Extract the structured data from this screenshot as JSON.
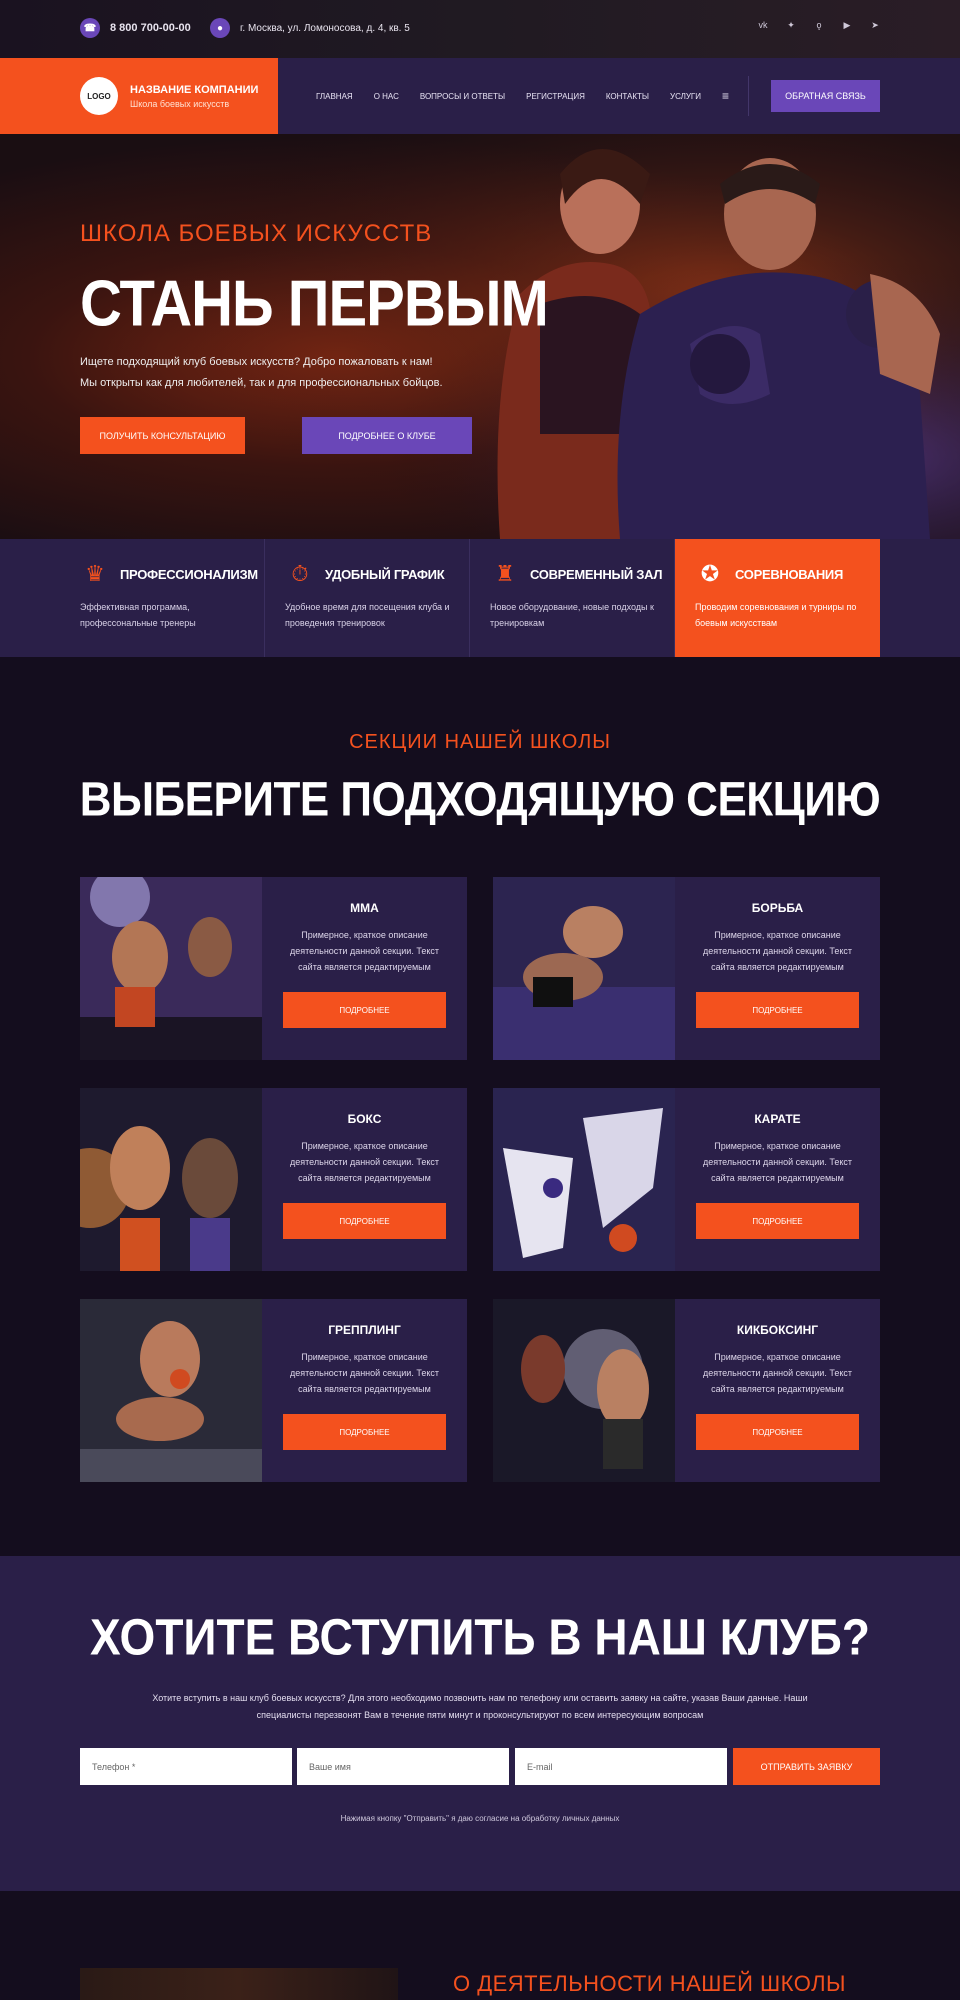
{
  "topbar": {
    "phone": "8 800 700-00-00",
    "address": "г. Москва, ул. Ломоносова, д. 4, кв. 5",
    "socials": [
      "vk",
      "twitter",
      "odnoklassniki",
      "youtube",
      "telegram"
    ]
  },
  "header": {
    "logo": "LOGO",
    "company_name": "НАЗВАНИЕ КОМПАНИИ",
    "company_sub": "Школа боевых искусств",
    "nav": [
      "ГЛАВНАЯ",
      "О НАС",
      "ВОПРОСЫ И ОТВЕТЫ",
      "РЕГИСТРАЦИЯ",
      "КОНТАКТЫ",
      "УСЛУГИ"
    ],
    "feedback": "ОБРАТНАЯ СВЯЗЬ"
  },
  "hero": {
    "subtitle": "ШКОЛА БОЕВЫХ ИСКУССТВ",
    "title": "СТАНЬ ПЕРВЫМ",
    "text_line1": "Ищете подходящий клуб боевых искусств? Добро пожаловать к нам!",
    "text_line2": "Мы открыты как для любителей, так и для профессиональных бойцов.",
    "btn_consult": "ПОЛУЧИТЬ КОНСУЛЬТАЦИЮ",
    "btn_more": "ПОДРОБНЕЕ О КЛУБЕ"
  },
  "features": [
    {
      "title": "ПРОФЕССИОНАЛИЗМ",
      "text": "Эффективная программа, професcональные тренеры",
      "icon": "award-icon"
    },
    {
      "title": "УДОБНЫЙ ГРАФИК",
      "text": "Удобное время для посещения клуба и проведения тренировок",
      "icon": "stopwatch-icon"
    },
    {
      "title": "СОВРЕМЕННЫЙ ЗАЛ",
      "text": "Новое оборудование, новые подходы к тренировкам",
      "icon": "gym-icon"
    },
    {
      "title": "СОРЕВНОВАНИЯ",
      "text": "Проводим соревнования и турниры по боевым искусствам",
      "icon": "medal-icon"
    }
  ],
  "sections": {
    "subtitle": "СЕКЦИИ НАШЕЙ ШКОЛЫ",
    "title": "ВЫБЕРИТЕ ПОДХОДЯЩУЮ СЕКЦИЮ",
    "cards": [
      {
        "title": "ММА",
        "text": "Примерное, краткое описание деятельности данной секции. Текст сайта является редактируемым",
        "button": "ПОДРОБНЕЕ"
      },
      {
        "title": "БОРЬБА",
        "text": "Примерное, краткое описание деятельности данной секции. Текст сайта является редактируемым",
        "button": "ПОДРОБНЕЕ"
      },
      {
        "title": "БОКС",
        "text": "Примерное, краткое описание деятельности данной секции. Текст сайта является редактируемым",
        "button": "ПОДРОБНЕЕ"
      },
      {
        "title": "КАРАТЕ",
        "text": "Примерное, краткое описание деятельности данной секции. Текст сайта является редактируемым",
        "button": "ПОДРОБНЕЕ"
      },
      {
        "title": "ГРЕППЛИНГ",
        "text": "Примерное, краткое описание деятельности данной секции. Текст сайта является редактируемым",
        "button": "ПОДРОБНЕЕ"
      },
      {
        "title": "КИКБОКСИНГ",
        "text": "Примерное, краткое описание деятельности данной секции. Текст сайта является редактируемым",
        "button": "ПОДРОБНЕЕ"
      }
    ]
  },
  "join": {
    "title": "ХОТИТЕ ВСТУПИТЬ В НАШ КЛУБ?",
    "text": "Хотите вступить в наш клуб боевых искусств? Для этого необходимо позвонить нам по телефону или оставить заявку на сайте, указав Ваши данные. Наши специалисты перезвонят Вам в течение пяти минут и проконсультируют по всем интересующим вопросам",
    "phone_placeholder": "Телефон *",
    "name_placeholder": "Ваше имя",
    "email_placeholder": "E-mail",
    "submit": "ОТПРАВИТЬ ЗАЯВКУ",
    "consent": "Нажимая кнопку \"Отправить\" я даю согласие на обработку личных данных"
  },
  "about": {
    "title": "О ДЕЯТЕЛЬНОСТИ НАШЕЙ ШКОЛЫ"
  },
  "colors": {
    "accent": "#f4511e",
    "purple": "#6a47b8",
    "panel": "#2a1f48",
    "background": "#140d1e"
  }
}
